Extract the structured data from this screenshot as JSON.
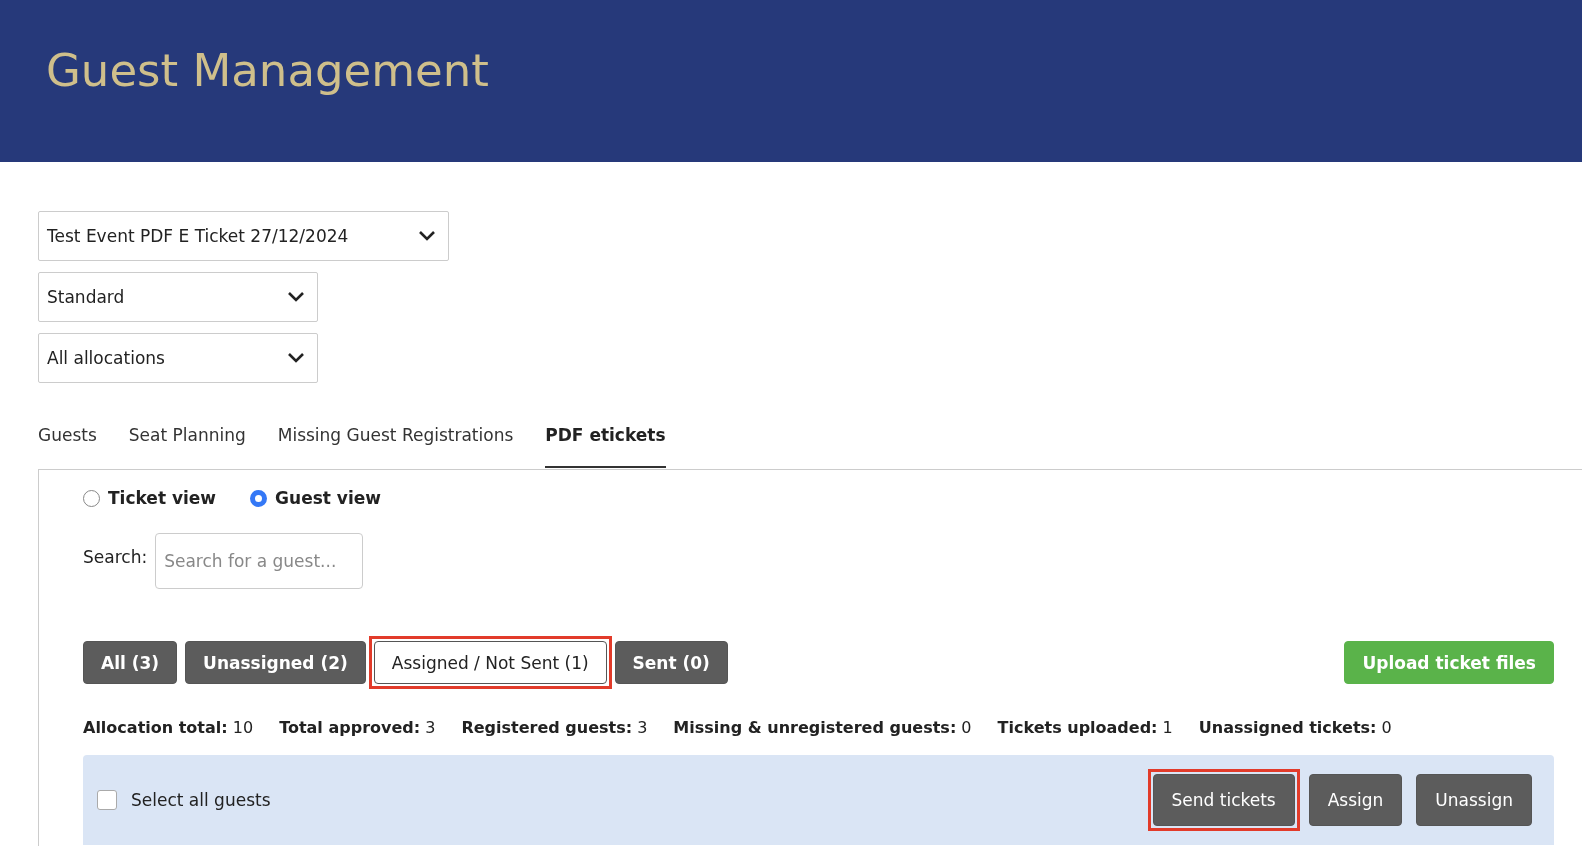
{
  "header": {
    "title": "Guest Management"
  },
  "selects": [
    {
      "value": "Test Event PDF E Ticket 27/12/2024"
    },
    {
      "value": "Standard"
    },
    {
      "value": "All allocations"
    }
  ],
  "tabs": [
    {
      "label": "Guests",
      "selected": false
    },
    {
      "label": "Seat Planning",
      "selected": false
    },
    {
      "label": "Missing Guest Registrations",
      "selected": false
    },
    {
      "label": "PDF etickets",
      "selected": true
    }
  ],
  "views": [
    {
      "label": "Ticket view",
      "selected": false
    },
    {
      "label": "Guest view",
      "selected": true
    }
  ],
  "search": {
    "label": "Search:",
    "placeholder": "Search for a guest..."
  },
  "filters": [
    {
      "label": "All (3)",
      "selected": false,
      "highlighted": false
    },
    {
      "label": "Unassigned (2)",
      "selected": false,
      "highlighted": false
    },
    {
      "label": "Assigned / Not Sent (1)",
      "selected": true,
      "highlighted": true
    },
    {
      "label": "Sent (0)",
      "selected": false,
      "highlighted": false
    }
  ],
  "upload_button": "Upload ticket files",
  "stats": [
    {
      "label": "Allocation total:",
      "value": "10"
    },
    {
      "label": "Total approved:",
      "value": "3"
    },
    {
      "label": "Registered guests:",
      "value": "3"
    },
    {
      "label": "Missing & unregistered guests:",
      "value": "0"
    },
    {
      "label": "Tickets uploaded:",
      "value": "1"
    },
    {
      "label": "Unassigned tickets:",
      "value": "0"
    }
  ],
  "selection_bar": {
    "select_all": {
      "label": "Select all guests",
      "checked": false
    },
    "actions": [
      {
        "label": "Send tickets",
        "highlighted": true
      },
      {
        "label": "Assign",
        "highlighted": false
      },
      {
        "label": "Unassign",
        "highlighted": false
      }
    ]
  }
}
